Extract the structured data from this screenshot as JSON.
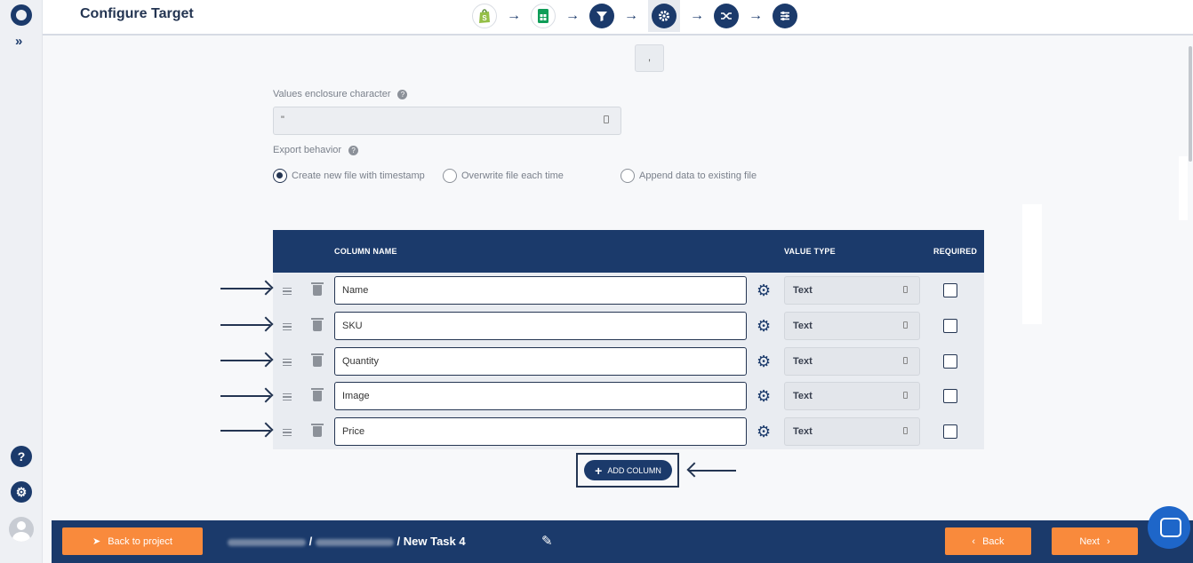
{
  "header": {
    "title": "Configure Target",
    "steps": [
      "shopify-icon",
      "google-sheets-icon",
      "filter-icon",
      "gear-icon",
      "shuffle-icon",
      "sliders-icon"
    ],
    "active_step": 4
  },
  "sidebar": {
    "expand_label": "»",
    "help_label": "?",
    "settings_label": "⚙"
  },
  "form": {
    "delimiter_value": ",",
    "enclosure_label": "Values enclosure character",
    "enclosure_value": "\"",
    "export_label": "Export behavior",
    "radios": [
      {
        "label": "Create new file with timestamp",
        "checked": true
      },
      {
        "label": "Overwrite file each time",
        "checked": false
      },
      {
        "label": "Append data to existing file",
        "checked": false
      }
    ]
  },
  "table": {
    "headers": {
      "column_name": "COLUMN NAME",
      "value_type": "VALUE TYPE",
      "required": "REQUIRED"
    },
    "rows": [
      {
        "name": "Name",
        "type": "Text",
        "required": false
      },
      {
        "name": "SKU",
        "type": "Text",
        "required": false
      },
      {
        "name": "Quantity",
        "type": "Text",
        "required": false
      },
      {
        "name": "Image",
        "type": "Text",
        "required": false
      },
      {
        "name": "Price",
        "type": "Text",
        "required": false
      }
    ],
    "add_column_label": "ADD COLUMN"
  },
  "footer": {
    "back_to_project": "Back to project",
    "breadcrumb_current": "New Task 4",
    "separator": "/",
    "back_label": "Back",
    "next_label": "Next"
  },
  "colors": {
    "primary": "#1b3a6b",
    "accent": "#f98a3c"
  }
}
